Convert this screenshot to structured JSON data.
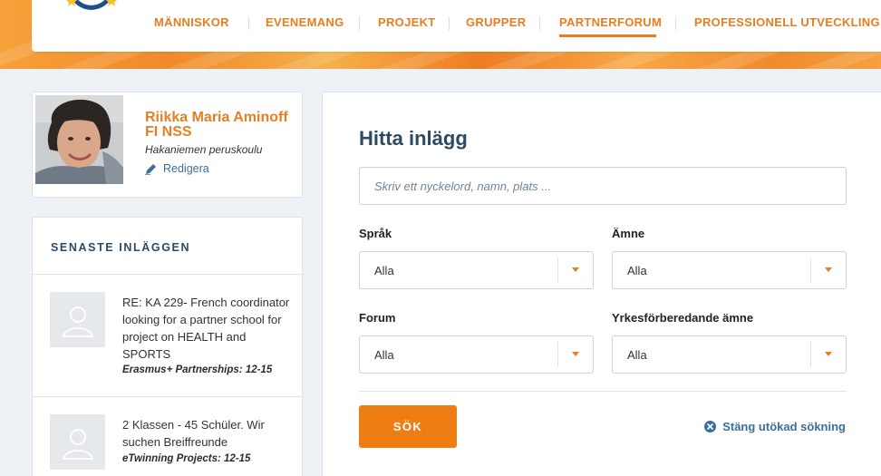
{
  "colors": {
    "accent": "#e67e22",
    "button": "#ee7d13",
    "heading": "#2c4a66",
    "link": "#3a6e9a"
  },
  "nav": {
    "items": [
      {
        "label": "MÄNNISKOR"
      },
      {
        "label": "EVENEMANG"
      },
      {
        "label": "PROJEKT"
      },
      {
        "label": "GRUPPER"
      },
      {
        "label": "PARTNERFORUM",
        "active": true
      },
      {
        "label": "PROFESSIONELL UTVECKLING"
      }
    ]
  },
  "profile": {
    "name": "Riikka Maria Aminoff FI NSS",
    "school": "Hakaniemen peruskoulu",
    "edit_label": "Redigera",
    "edit_icon": "pencil-icon"
  },
  "latest": {
    "title": "SENASTE INLÄGGEN",
    "posts": [
      {
        "text": "RE: KA 229- French coordinator looking for a partner school for project on HEALTH and SPORTS",
        "meta": "Erasmus+ Partnerships: 12-15"
      },
      {
        "text": "2 Klassen - 45 Schüler. Wir suchen Breiffreunde",
        "meta": "eTwinning Projects: 12-15"
      }
    ]
  },
  "search": {
    "title": "Hitta inlägg",
    "placeholder": "Skriv ett nyckelord, namn, plats ...",
    "filters": {
      "sprak": {
        "label": "Språk",
        "value": "Alla"
      },
      "amne": {
        "label": "Ämne",
        "value": "Alla"
      },
      "forum": {
        "label": "Forum",
        "value": "Alla"
      },
      "yrke": {
        "label": "Yrkesförberedande ämne",
        "value": "Alla"
      }
    },
    "submit_label": "SÖK",
    "close_advanced_label": "Stäng utökad sökning",
    "close_icon": "close-circle-icon"
  }
}
